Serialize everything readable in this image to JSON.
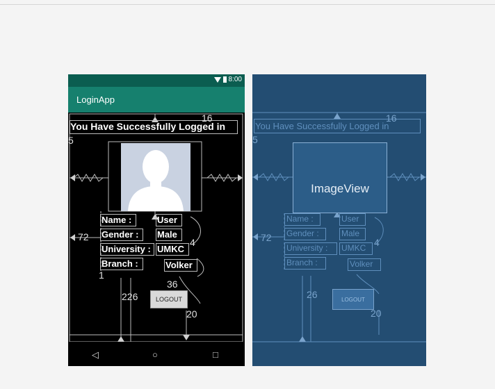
{
  "status_bar": {
    "time": "8:00"
  },
  "app": {
    "title": "LoginApp"
  },
  "design": {
    "headline": "You Have Successfully Logged in",
    "labels": {
      "name": "Name :",
      "gender": "Gender :",
      "university": "University :",
      "branch": "Branch :"
    },
    "values": {
      "name": "User",
      "gender": "Male",
      "university": "UMKC",
      "branch": "Volker"
    },
    "logout_label": "LOGOUT",
    "dimensions": {
      "top_right": "16",
      "left_small": "5",
      "left_margin": "72",
      "right_margin": "4",
      "logout_top": "36",
      "logout_left": "226",
      "logout_bottom": "20",
      "small_one": "1"
    }
  },
  "blueprint": {
    "headline": "You Have Successfully Logged in",
    "imageview_label": "ImageView",
    "labels": {
      "name": "Name :",
      "gender": "Gender :",
      "university": "University :",
      "branch": "Branch :"
    },
    "values": {
      "name": "User",
      "gender": "Male",
      "university": "UMKC",
      "branch": "Volker"
    },
    "logout_label": "LOGOUT",
    "dimensions": {
      "top_right": "16",
      "left_small": "5",
      "left_margin": "72",
      "right_margin": "4",
      "logout_left": "26",
      "logout_bottom": "20"
    }
  },
  "nav": {
    "back": "◁",
    "home": "○",
    "recents": "□"
  },
  "colors": {
    "statusbar": "#0b5d50",
    "appbar": "#16806e",
    "blueprint": "#234d72",
    "blueprint_line": "#5f8fbd"
  }
}
